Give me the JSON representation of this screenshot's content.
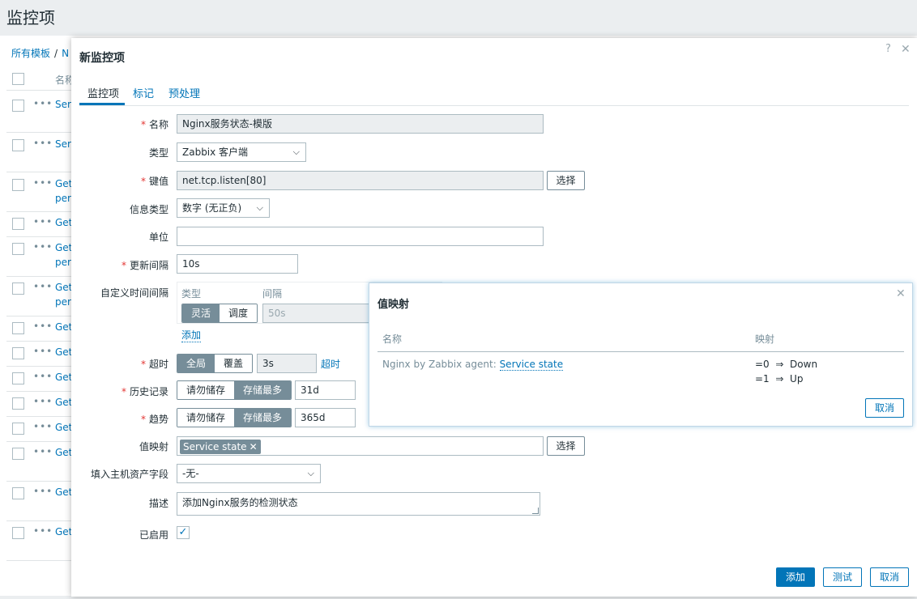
{
  "page": {
    "title": "监控项"
  },
  "background": {
    "breadcrumb": [
      "所有模板",
      "N"
    ],
    "header_name": "名称",
    "rows": [
      "Ser",
      "Ser",
      "Get",
      "Get",
      "Get",
      "Get",
      "Get",
      "Get",
      "Get",
      "Get",
      "Get",
      "Get",
      "Get",
      "Get"
    ],
    "row_suffix": "per"
  },
  "dialog": {
    "title": "新监控项",
    "help_glyph": "?",
    "close_glyph": "✕",
    "tabs": [
      "监控项",
      "标记",
      "预处理"
    ],
    "fields": {
      "name": {
        "label": "名称",
        "value": "Nginx服务状态-模版"
      },
      "type": {
        "label": "类型",
        "value": "Zabbix 客户端"
      },
      "key": {
        "label": "键值",
        "value": "net.tcp.listen[80]",
        "button": "选择"
      },
      "info_type": {
        "label": "信息类型",
        "value": "数字 (无正负)"
      },
      "units": {
        "label": "单位",
        "value": ""
      },
      "update_interval": {
        "label": "更新间隔",
        "value": "10s"
      },
      "custom_intervals": {
        "label": "自定义时间间隔",
        "col_type": "类型",
        "col_interval": "间隔",
        "options": [
          "灵活",
          "调度"
        ],
        "interval_placeholder": "50s",
        "add": "添加"
      },
      "timeout": {
        "label": "超时",
        "options": [
          "全局",
          "覆盖"
        ],
        "value": "3s",
        "link": "超时"
      },
      "history": {
        "label": "历史记录",
        "options": [
          "请勿储存",
          "存储最多"
        ],
        "value": "31d"
      },
      "trends": {
        "label": "趋势",
        "options": [
          "请勿储存",
          "存储最多"
        ],
        "value": "365d"
      },
      "valuemap": {
        "label": "值映射",
        "tag": "Service state",
        "tag_remove": "✕",
        "button": "选择"
      },
      "inventory": {
        "label": "填入主机资产字段",
        "value": "-无-"
      },
      "description": {
        "label": "描述",
        "value": "添加Nginx服务的检测状态"
      },
      "enabled": {
        "label": "已启用",
        "checked": true,
        "glyph": "✓"
      }
    },
    "required_marker": "*",
    "buttons": {
      "add": "添加",
      "test": "测试",
      "cancel": "取消"
    }
  },
  "popup": {
    "title": "值映射",
    "close_glyph": "✕",
    "col_name": "名称",
    "col_mapping": "映射",
    "row": {
      "prefix": "Nginx by Zabbix agent: ",
      "link": "Service state",
      "mappings": [
        {
          "value": "=0",
          "arrow": "⇒",
          "text": "Down"
        },
        {
          "value": "=1",
          "arrow": "⇒",
          "text": "Up"
        }
      ]
    },
    "cancel": "取消"
  },
  "colors": {
    "accent": "#0275b8",
    "required": "#e33734",
    "toggle_on": "#768d99"
  }
}
